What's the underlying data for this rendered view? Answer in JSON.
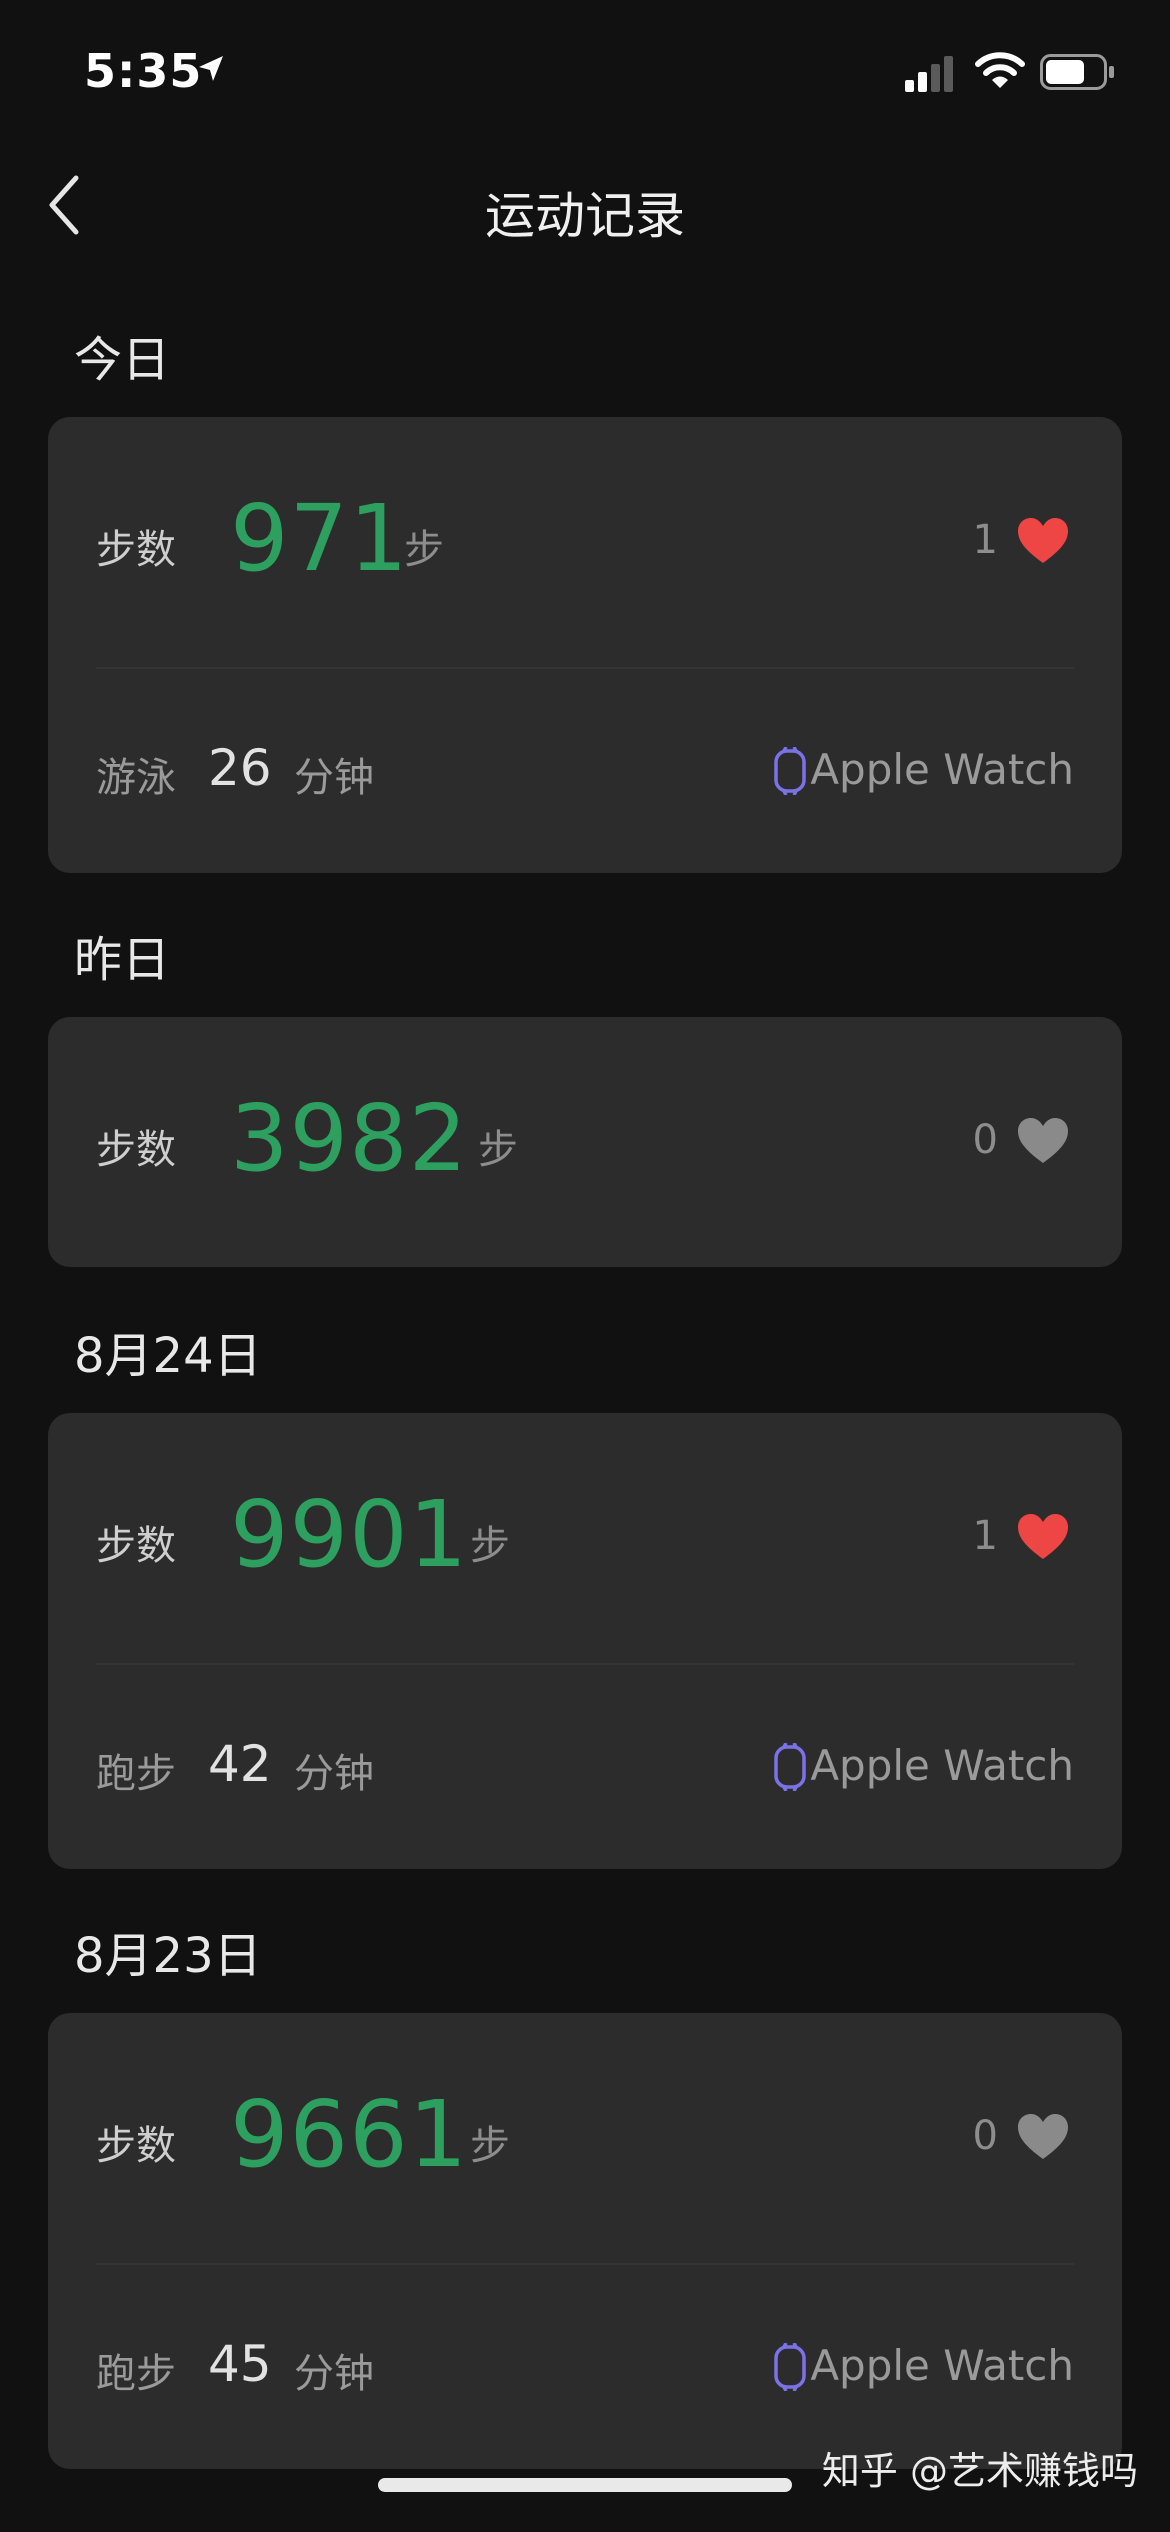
{
  "status_bar": {
    "time": "5:35"
  },
  "nav": {
    "title": "运动记录"
  },
  "labels": {
    "steps": "步数",
    "steps_unit": "步",
    "minutes_unit": "分钟"
  },
  "days": [
    {
      "title": "今日",
      "steps": "971",
      "likes": "1",
      "liked": true,
      "activity": {
        "name": "游泳",
        "minutes": "26",
        "source": "Apple Watch"
      }
    },
    {
      "title": "昨日",
      "steps": "3982",
      "likes": "0",
      "liked": false,
      "activity": null
    },
    {
      "title": "8月24日",
      "steps": "9901",
      "likes": "1",
      "liked": true,
      "activity": {
        "name": "跑步",
        "minutes": "42",
        "source": "Apple Watch"
      }
    },
    {
      "title": "8月23日",
      "steps": "9661",
      "likes": "0",
      "liked": false,
      "activity": {
        "name": "跑步",
        "minutes": "45",
        "source": "Apple Watch"
      }
    }
  ],
  "watermark": "知乎 @艺术赚钱吗",
  "colors": {
    "steps_green": "#2da05f",
    "heart_red": "#ee4545",
    "heart_grey": "#8a8a8a",
    "watch_purple": "#7b72e8"
  }
}
